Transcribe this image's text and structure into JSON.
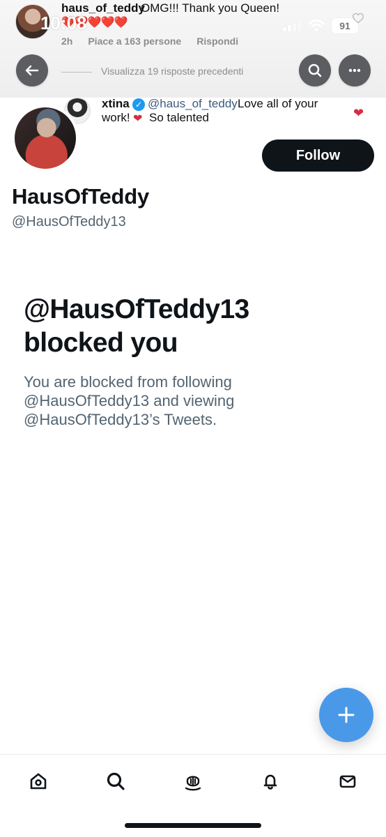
{
  "overlay": {
    "status_time": "10:08",
    "battery": "91",
    "comment": {
      "username": "haus_of_teddy",
      "text": "OMG!!! Thank you Queen!",
      "hearts": "❤️❤️❤️❤️❤️",
      "age": "2h",
      "likes": "Piace a 163 persone",
      "reply": "Rispondi"
    },
    "view_replies": "Visualizza 19 risposte precedenti",
    "reply": {
      "username": "xtina",
      "mention": "@haus_of_teddy",
      "text_part1": "Love all of your",
      "text_part2": "work!",
      "text_part3": "So talented"
    }
  },
  "profile": {
    "follow_label": "Follow",
    "display_name": "HausOfTeddy",
    "handle": "@HausOfTeddy13"
  },
  "blocked": {
    "title_line1": "@HausOfTeddy13",
    "title_line2": "blocked you",
    "desc_line1": "You are blocked from following",
    "desc_line2": "@HausOfTeddy13 and viewing",
    "desc_line3": "@HausOfTeddy13’s Tweets."
  },
  "bottom_nav": {
    "items": [
      {
        "name": "home",
        "icon": "home-icon"
      },
      {
        "name": "search",
        "icon": "search-icon"
      },
      {
        "name": "spaces",
        "icon": "spaces-icon"
      },
      {
        "name": "notifications",
        "icon": "bell-icon"
      },
      {
        "name": "messages",
        "icon": "mail-icon"
      }
    ]
  },
  "colors": {
    "primary_text": "#0f1419",
    "secondary_text": "#536471",
    "follow_bg": "#0f1419",
    "fab_bg": "#4a99e9",
    "verified": "#1d9bf0",
    "heart": "#d62d42"
  }
}
